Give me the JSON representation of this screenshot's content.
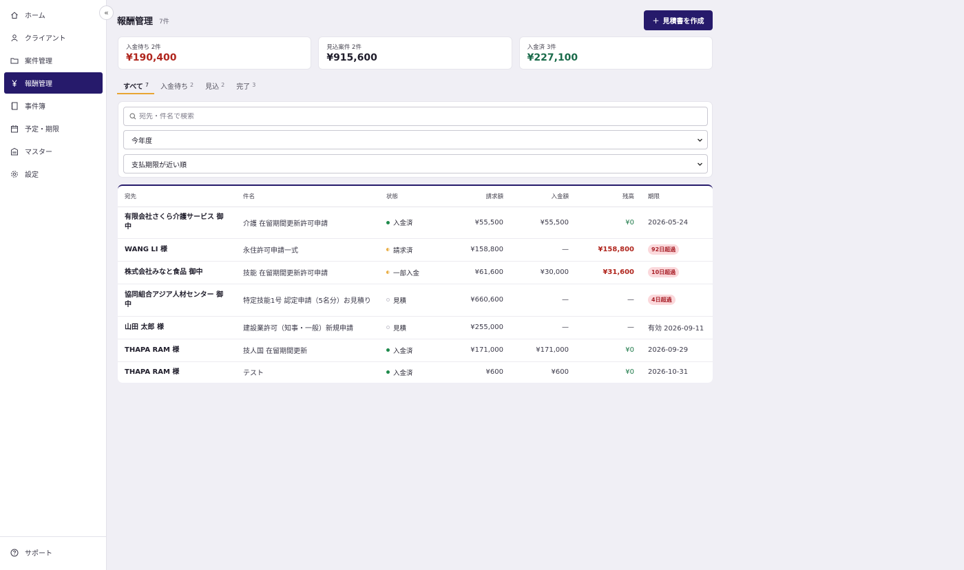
{
  "sidebar": {
    "collapse_label": "«",
    "items": [
      {
        "label": "ホーム",
        "icon": "home-icon"
      },
      {
        "label": "クライアント",
        "icon": "user-icon"
      },
      {
        "label": "案件管理",
        "icon": "folder-icon"
      },
      {
        "label": "報酬管理",
        "icon": "yen-icon",
        "active": true
      },
      {
        "label": "事件簿",
        "icon": "notebook-icon"
      },
      {
        "label": "予定・期限",
        "icon": "calendar-icon"
      },
      {
        "label": "マスター",
        "icon": "building-icon"
      },
      {
        "label": "設定",
        "icon": "gear-icon"
      }
    ],
    "support_label": "サポート"
  },
  "header": {
    "title": "報酬管理",
    "count": "7件",
    "create_button": "見積書を作成",
    "create_icon": "+"
  },
  "summary": [
    {
      "label": "入金待ち 2件",
      "value": "¥190,400",
      "color": "#b0261e"
    },
    {
      "label": "見込案件 2件",
      "value": "¥915,600",
      "color": "#1f1d2b"
    },
    {
      "label": "入金済 3件",
      "value": "¥227,100",
      "color": "#1a6b4a"
    }
  ],
  "tabs": [
    {
      "label": "すべて",
      "count": "7",
      "active": true
    },
    {
      "label": "入金待ち",
      "count": "2"
    },
    {
      "label": "見込",
      "count": "2"
    },
    {
      "label": "完了",
      "count": "3"
    }
  ],
  "filters": {
    "search_placeholder": "宛先・件名で検索",
    "period": "今年度",
    "sort": "支払期限が近い順"
  },
  "table": {
    "columns": [
      "宛先",
      "件名",
      "状態",
      "請求額",
      "入金額",
      "残高",
      "期限"
    ],
    "rows": [
      {
        "client": "有限会社さくら介護サービス 御中",
        "subject": "介護 在留期間更新許可申請",
        "status": "入金済",
        "status_kind": "paid",
        "billed": "¥55,500",
        "paid": "¥55,500",
        "balance": "¥0",
        "balance_kind": "zero",
        "due": "2026-05-24",
        "due_kind": "text"
      },
      {
        "client": "WANG LI 様",
        "subject": "永住許可申請一式",
        "status": "請求済",
        "status_kind": "half",
        "billed": "¥158,800",
        "paid": "—",
        "balance": "¥158,800",
        "balance_kind": "neg",
        "due": "92日超過",
        "due_kind": "badge"
      },
      {
        "client": "株式会社みなと食品 御中",
        "subject": "技能 在留期間更新許可申請",
        "status": "一部入金",
        "status_kind": "half",
        "billed": "¥61,600",
        "paid": "¥30,000",
        "balance": "¥31,600",
        "balance_kind": "neg",
        "due": "10日超過",
        "due_kind": "badge"
      },
      {
        "client": "協同組合アジア人材センター 御中",
        "subject": "特定技能1号 認定申請（5名分）お見積り",
        "status": "見積",
        "status_kind": "est",
        "billed": "¥660,600",
        "paid": "—",
        "balance": "—",
        "balance_kind": "plain",
        "due": "4日超過",
        "due_kind": "badge"
      },
      {
        "client": "山田 太郎 様",
        "subject": "建設業許可（知事・一般）新規申請",
        "status": "見積",
        "status_kind": "est",
        "billed": "¥255,000",
        "paid": "—",
        "balance": "—",
        "balance_kind": "plain",
        "due": "有効 2026-09-11",
        "due_kind": "text"
      },
      {
        "client": "THAPA RAM 様",
        "subject": "技人国 在留期間更新",
        "status": "入金済",
        "status_kind": "paid",
        "billed": "¥171,000",
        "paid": "¥171,000",
        "balance": "¥0",
        "balance_kind": "zero",
        "due": "2026-09-29",
        "due_kind": "text"
      },
      {
        "client": "THAPA RAM 様",
        "subject": "テスト",
        "status": "入金済",
        "status_kind": "paid",
        "billed": "¥600",
        "paid": "¥600",
        "balance": "¥0",
        "balance_kind": "zero",
        "due": "2026-10-31",
        "due_kind": "text"
      }
    ]
  }
}
